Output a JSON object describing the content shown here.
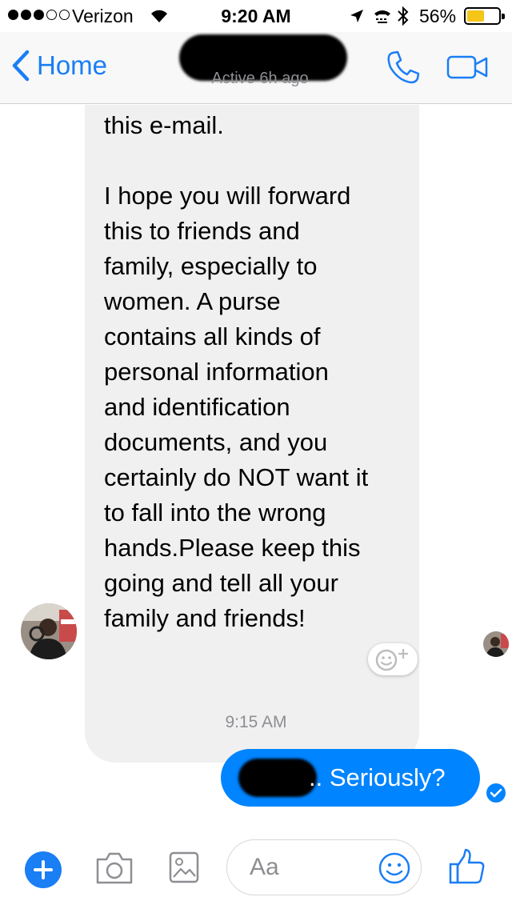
{
  "status_bar": {
    "carrier": "Verizon",
    "time": "9:20 AM",
    "battery_percent": "56%",
    "battery_level": 0.56
  },
  "nav": {
    "back_label": "Home",
    "subtitle": "Active 6h ago"
  },
  "thread": {
    "received_message": "thankful that you read\nthis e-mail.\n\nI hope you will forward\nthis to friends and\nfamily, especially to\nwomen.  A purse\ncontains all kinds  of\npersonal information\nand identification\ndocuments, and you\ncertainly do NOT want it\nto fall into the wrong\nhands.Please keep this\ngoing and tell all your\nfamily and friends!",
    "timestamp": "9:15 AM",
    "sent_message": ".. Seriously?"
  },
  "composer": {
    "placeholder": "Aa"
  },
  "colors": {
    "accent": "#1a7ef5",
    "sent_bubble": "#0084ff",
    "received_bubble": "#f1f0f0"
  },
  "icons": [
    "back-chevron-icon",
    "phone-icon",
    "video-camera-icon",
    "add-emoji-reaction-icon",
    "delivered-check-icon",
    "plus-icon",
    "camera-icon",
    "image-gallery-icon",
    "smiley-icon",
    "thumbs-up-icon"
  ]
}
